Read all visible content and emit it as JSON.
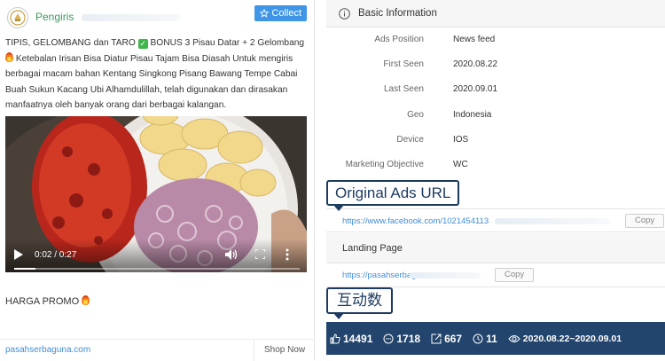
{
  "advertiser": {
    "name": "Pengiris",
    "collect_label": "Collect"
  },
  "ad": {
    "text_line1_a": "TIPIS, GELOMBANG dan TARO",
    "text_line1_b": "BONUS 3 Pisau Datar + 2 Gelombang",
    "text_rest": "Ketebalan Irisan Bisa Diatur Pisau Tajam Bisa Diasah Untuk mengiris berbagai macam bahan Kentang Singkong Pisang Bawang Tempe Cabai Buah Sukun Kacang Ubi Alhamdulillah, telah digunakan dan dirasakan manfaatnya oleh banyak orang dari berbagai kalangan.",
    "promo": "HARGA PROMO",
    "video": {
      "time": "0:02 / 0:27",
      "progress": 0.074
    },
    "cta_url": "pasahserbaguna.com",
    "cta_button": "Shop Now"
  },
  "basic_info": {
    "title": "Basic Information",
    "rows": [
      {
        "label": "Ads Position",
        "value": "News feed"
      },
      {
        "label": "First Seen",
        "value": "2020.08.22"
      },
      {
        "label": "Last Seen",
        "value": "2020.09.01"
      },
      {
        "label": "Geo",
        "value": "Indonesia"
      },
      {
        "label": "Device",
        "value": "IOS"
      },
      {
        "label": "Marketing Objective",
        "value": "WC"
      }
    ]
  },
  "annotations": {
    "original_ads_url": "Original Ads URL",
    "interactions": "互动数"
  },
  "original_url": {
    "text": "https://www.facebook.com/1021454113",
    "copy_label": "Copy"
  },
  "landing_page": {
    "title": "Landing Page",
    "url": "https://pasahserbagu",
    "copy_label": "Copy"
  },
  "stats": {
    "likes": "14491",
    "comments": "1718",
    "shares": "667",
    "days": "11",
    "date_range": "2020.08.22~2020.09.01"
  },
  "colors": {
    "accent_blue": "#3f95e6",
    "stats_bg": "#23456d",
    "link": "#3f8ed8",
    "advertiser_green": "#3a9a5a"
  }
}
